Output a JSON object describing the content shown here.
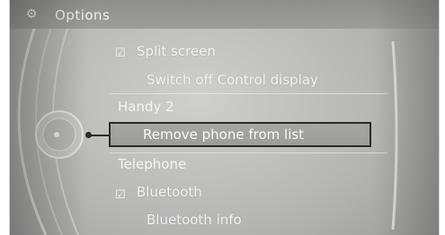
{
  "header": {
    "title": "Options",
    "icon": "options-icon"
  },
  "menu": {
    "split_screen": "Split screen",
    "switch_off": "Switch off Control display",
    "section_handy": "Handy 2",
    "remove_phone": "Remove phone from list",
    "section_telephone": "Telephone",
    "bluetooth": "Bluetooth",
    "bluetooth_info": "Bluetooth info"
  },
  "colors": {
    "selection_border": "#2a2a2a",
    "text": "#f4f4f4"
  }
}
